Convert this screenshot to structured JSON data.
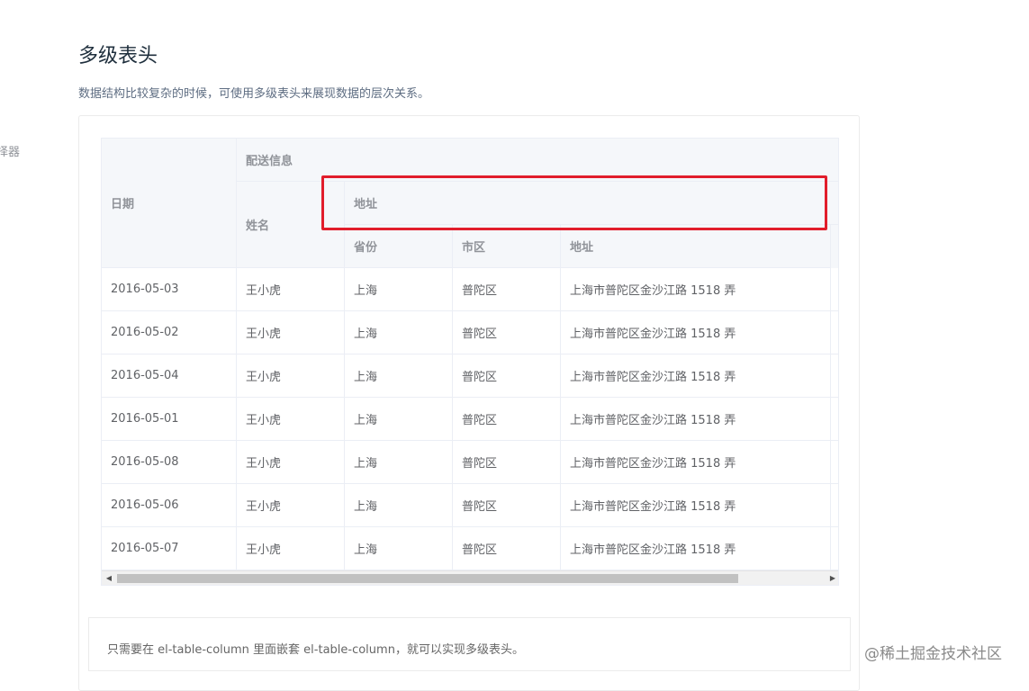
{
  "sidebar_fragment": "选择器",
  "title": "多级表头",
  "description": "数据结构比较复杂的时候，可使用多级表头来展现数据的层次关系。",
  "table": {
    "headers": {
      "date": "日期",
      "delivery": "配送信息",
      "name": "姓名",
      "address_group": "地址",
      "province": "省份",
      "city": "市区",
      "address": "地址"
    },
    "rows": [
      {
        "date": "2016-05-03",
        "name": "王小虎",
        "province": "上海",
        "city": "普陀区",
        "address": "上海市普陀区金沙江路 1518 弄"
      },
      {
        "date": "2016-05-02",
        "name": "王小虎",
        "province": "上海",
        "city": "普陀区",
        "address": "上海市普陀区金沙江路 1518 弄"
      },
      {
        "date": "2016-05-04",
        "name": "王小虎",
        "province": "上海",
        "city": "普陀区",
        "address": "上海市普陀区金沙江路 1518 弄"
      },
      {
        "date": "2016-05-01",
        "name": "王小虎",
        "province": "上海",
        "city": "普陀区",
        "address": "上海市普陀区金沙江路 1518 弄"
      },
      {
        "date": "2016-05-08",
        "name": "王小虎",
        "province": "上海",
        "city": "普陀区",
        "address": "上海市普陀区金沙江路 1518 弄"
      },
      {
        "date": "2016-05-06",
        "name": "王小虎",
        "province": "上海",
        "city": "普陀区",
        "address": "上海市普陀区金沙江路 1518 弄"
      },
      {
        "date": "2016-05-07",
        "name": "王小虎",
        "province": "上海",
        "city": "普陀区",
        "address": "上海市普陀区金沙江路 1518 弄"
      }
    ]
  },
  "scrollbar": {
    "left_arrow": "◀",
    "right_arrow": "▶"
  },
  "tip": "只需要在 el-table-column 里面嵌套 el-table-column，就可以实现多级表头。",
  "watermark": "@稀土掘金技术社区",
  "colors": {
    "highlight": "#e11d2b",
    "header_bg": "#f5f7fa",
    "border": "#ebeef5"
  }
}
